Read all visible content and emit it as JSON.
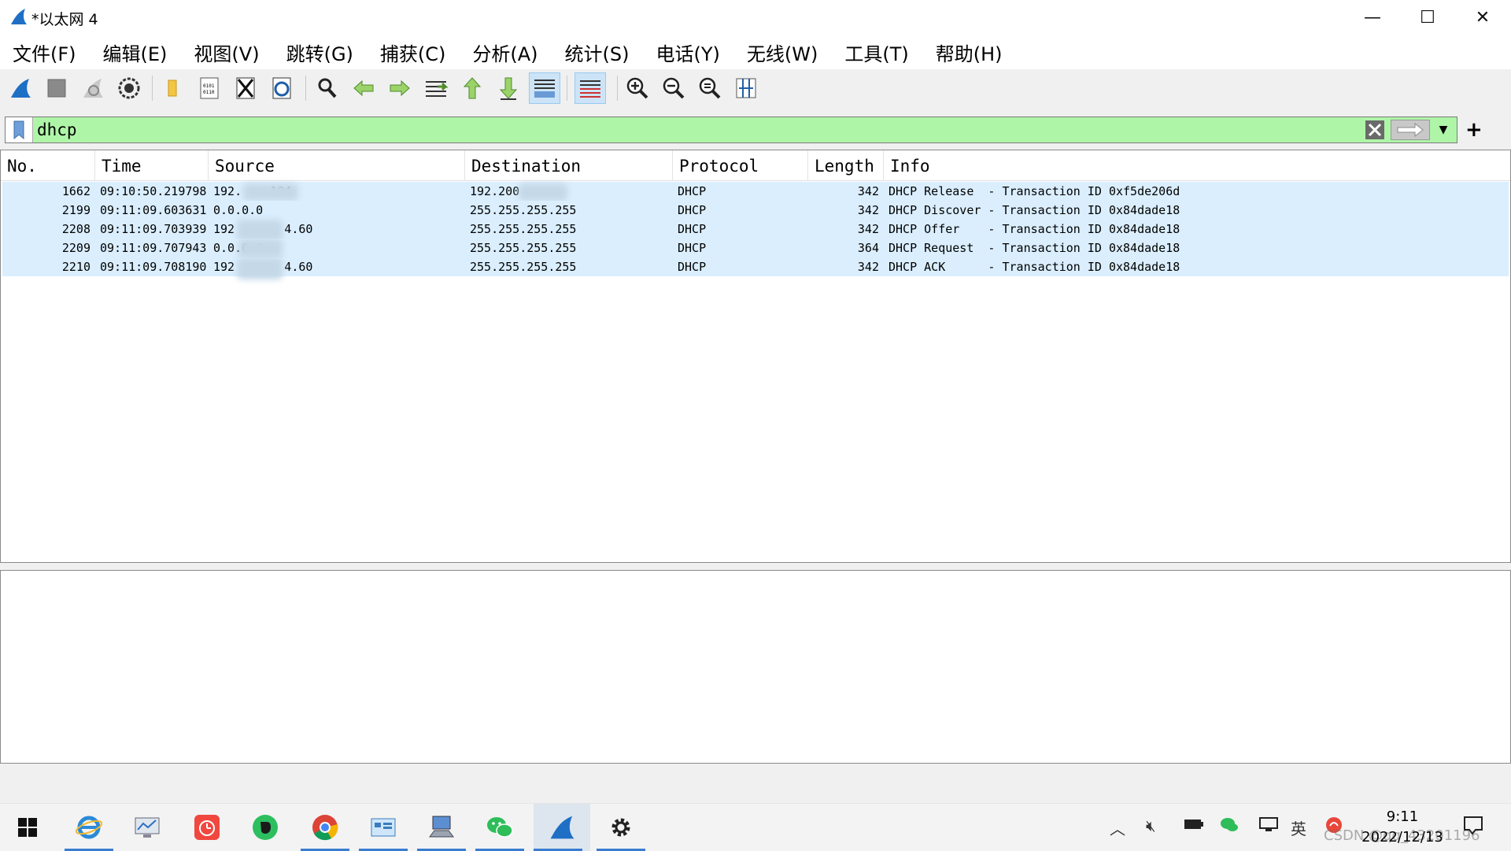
{
  "window": {
    "title": "*以太网 4",
    "minimize": "—",
    "maximize": "☐",
    "close": "✕"
  },
  "menu": [
    "文件(F)",
    "编辑(E)",
    "视图(V)",
    "跳转(G)",
    "捕获(C)",
    "分析(A)",
    "统计(S)",
    "电话(Y)",
    "无线(W)",
    "工具(T)",
    "帮助(H)"
  ],
  "filter": {
    "value": "dhcp",
    "background": "#aff5a8"
  },
  "packet_list": {
    "columns": [
      "No.",
      "Time",
      "Source",
      "Destination",
      "Protocol",
      "Length",
      "Info"
    ],
    "rows": [
      {
        "no": "1662",
        "time": "09:10:50.219798",
        "source": "192.    104",
        "destination": "192.200",
        "protocol": "DHCP",
        "length": "342",
        "info": "DHCP Release  - Transaction ID 0xf5de206d"
      },
      {
        "no": "2199",
        "time": "09:11:09.603631",
        "source": "0.0.0.0",
        "destination": "255.255.255.255",
        "protocol": "DHCP",
        "length": "342",
        "info": "DHCP Discover - Transaction ID 0x84dade18"
      },
      {
        "no": "2208",
        "time": "09:11:09.703939",
        "source": "192       4.60",
        "destination": "255.255.255.255",
        "protocol": "DHCP",
        "length": "342",
        "info": "DHCP Offer    - Transaction ID 0x84dade18"
      },
      {
        "no": "2209",
        "time": "09:11:09.707943",
        "source": "0.0.0.0",
        "destination": "255.255.255.255",
        "protocol": "DHCP",
        "length": "364",
        "info": "DHCP Request  - Transaction ID 0x84dade18"
      },
      {
        "no": "2210",
        "time": "09:11:09.708190",
        "source": "192       4.60",
        "destination": "255.255.255.255",
        "protocol": "DHCP",
        "length": "342",
        "info": "DHCP ACK      - Transaction ID 0x84dade18"
      }
    ],
    "row_color": "#daeefe"
  },
  "taskbar": {
    "apps": [
      "windows-start",
      "internet-explorer",
      "network-monitor",
      "calendar-app",
      "evernote",
      "chrome",
      "control-panel",
      "remote-desktop",
      "wechat",
      "wireshark",
      "settings"
    ],
    "clock_time": "9:11",
    "clock_date": "2022/12/13",
    "watermark": "CSDN @qq_43201196"
  }
}
